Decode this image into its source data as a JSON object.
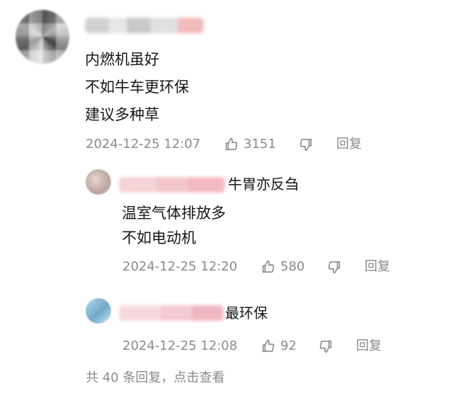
{
  "main_comment": {
    "lines": [
      "内燃机虽好",
      "不如牛车更环保",
      "建议多种草"
    ],
    "timestamp": "2024-12-25 12:07",
    "likes": "3151",
    "reply_label": "回复"
  },
  "replies": [
    {
      "handle_suffix": "牛胃亦反刍",
      "lines": [
        "温室气体排放多",
        "不如电动机"
      ],
      "timestamp": "2024-12-25 12:20",
      "likes": "580",
      "reply_label": "回复"
    },
    {
      "handle_suffix": "最环保",
      "timestamp": "2024-12-25 12:08",
      "likes": "92",
      "reply_label": "回复"
    }
  ],
  "footer": {
    "more_replies": "共 40 条回复，点击查看"
  },
  "icons": {
    "like": "thumbs-up-icon",
    "dislike": "thumbs-down-icon"
  },
  "colors": {
    "text": "#161616",
    "meta": "#8a8a8a",
    "background": "#ffffff"
  }
}
